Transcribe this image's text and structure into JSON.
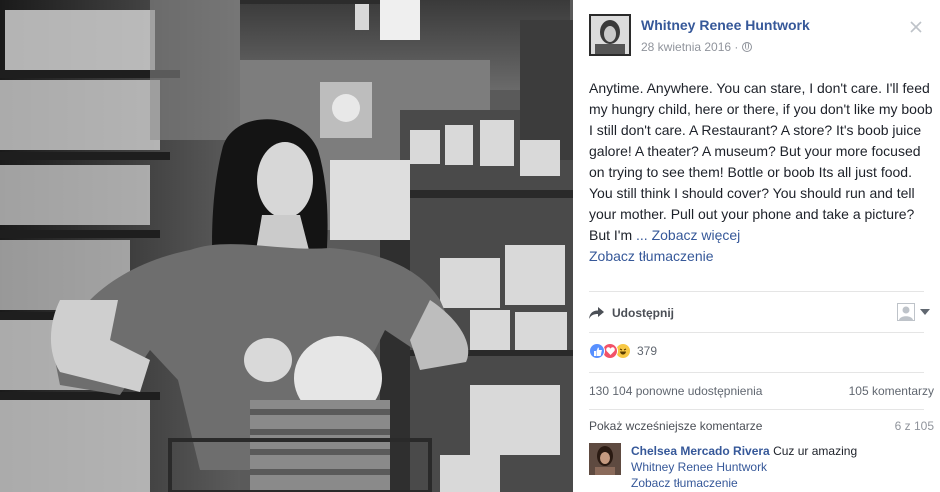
{
  "post": {
    "author": "Whitney Renee Huntwork",
    "date": "28 kwietnia 2016 ·",
    "privacy_icon": "globe-icon",
    "text": "Anytime. Anywhere. You can stare, I don't care. I'll feed my hungry child, here or there, if you don't like my boob I still don't care. A Restaurant? A store? It's boob juice galore! A theater? A museum? But your more focused on trying to see them! Bottle or boob Its all just food. You still think I should cover? You should run and tell your mother. Pull out your phone and take a picture? But I'm ",
    "see_more": "... Zobacz więcej",
    "see_translation": "Zobacz tłumaczenie"
  },
  "actions": {
    "share_label": "Udostępnij"
  },
  "reactions": {
    "icons": [
      "like-icon",
      "love-icon",
      "haha-icon"
    ],
    "count": "379"
  },
  "stats": {
    "shares": "130 104 ponowne udostępnienia",
    "comments": "105 komentarzy"
  },
  "comments_section": {
    "show_previous": "Pokaż wcześniejsze komentarze",
    "page_info": "6 z 105",
    "items": [
      {
        "author": "Chelsea Mercado Rivera",
        "text": "Cuz ur amazing",
        "mention": "Whitney Renee Huntwork",
        "translate": "Zobacz tłumaczenie"
      }
    ]
  },
  "colors": {
    "link": "#365899",
    "secondary_text": "#90949c",
    "like": "#5890ff",
    "love": "#f25268",
    "haha": "#f7c844"
  }
}
